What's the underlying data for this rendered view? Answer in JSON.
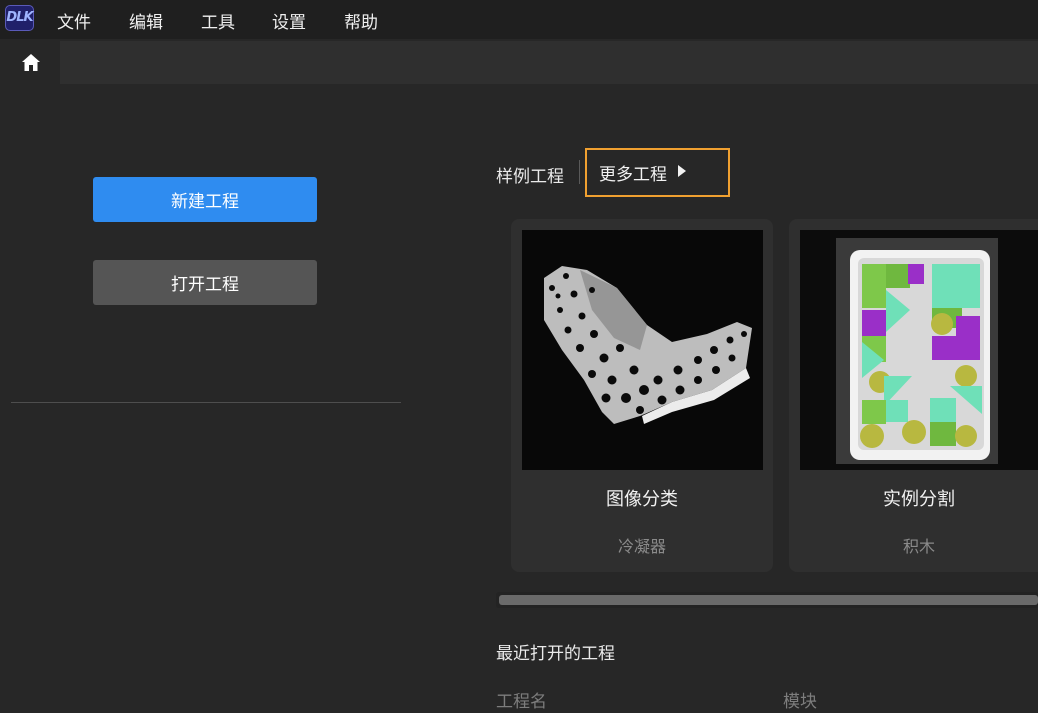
{
  "app": {
    "logo_text": "DLK"
  },
  "menu": {
    "items": [
      "文件",
      "编辑",
      "工具",
      "设置",
      "帮助"
    ]
  },
  "tabs": {
    "home_icon": "home-icon"
  },
  "left_panel": {
    "new_project": "新建工程",
    "open_project": "打开工程"
  },
  "examples": {
    "label": "样例工程",
    "more_label": "更多工程",
    "more_icon": "caret-right-icon",
    "cards": [
      {
        "title": "图像分类",
        "subtitle": "冷凝器"
      },
      {
        "title": "实例分割",
        "subtitle": "积木"
      }
    ]
  },
  "recent": {
    "title": "最近打开的工程",
    "columns": [
      "工程名",
      "模块"
    ]
  },
  "colors": {
    "accent": "#2f8cf0",
    "highlight": "#f0a030",
    "background": "#272727"
  }
}
